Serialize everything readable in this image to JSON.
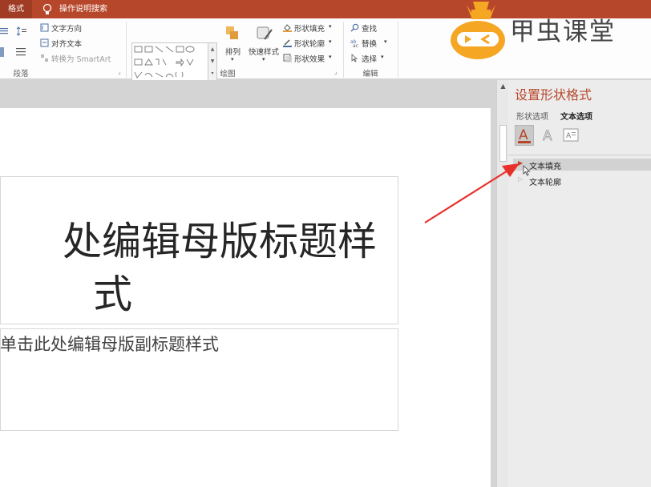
{
  "tabs": {
    "format_label": "格式",
    "tell_me_label": "操作说明搜索"
  },
  "ribbon": {
    "paragraph": {
      "text_direction": "文字方向",
      "align_text": "对齐文本",
      "convert_smartart": "转换为 SmartArt",
      "group_label": "段落"
    },
    "drawing": {
      "arrange": "排列",
      "quick_styles": "快速样式",
      "shape_fill": "形状填充",
      "shape_outline": "形状轮廓",
      "shape_effects": "形状效果",
      "group_label": "绘图"
    },
    "editing": {
      "find": "查找",
      "replace": "替换",
      "select": "选择",
      "group_label": "编辑"
    }
  },
  "brand": {
    "text": "甲虫课堂"
  },
  "slide": {
    "title_line1": "处编辑母版标题样",
    "title_line2": "式",
    "subtitle": "单击此处编辑母版副标题样式"
  },
  "pane": {
    "title": "设置形状格式",
    "tab_shape_options": "形状选项",
    "tab_text_options": "文本选项",
    "rows": [
      {
        "label": "文本填充",
        "expanded": false,
        "highlighted": true
      },
      {
        "label": "文本轮廓",
        "expanded": false,
        "highlighted": false
      }
    ]
  },
  "colors": {
    "accent": "#b7472a",
    "arrow": "#e8302a",
    "brand_orange": "#f5a623"
  }
}
